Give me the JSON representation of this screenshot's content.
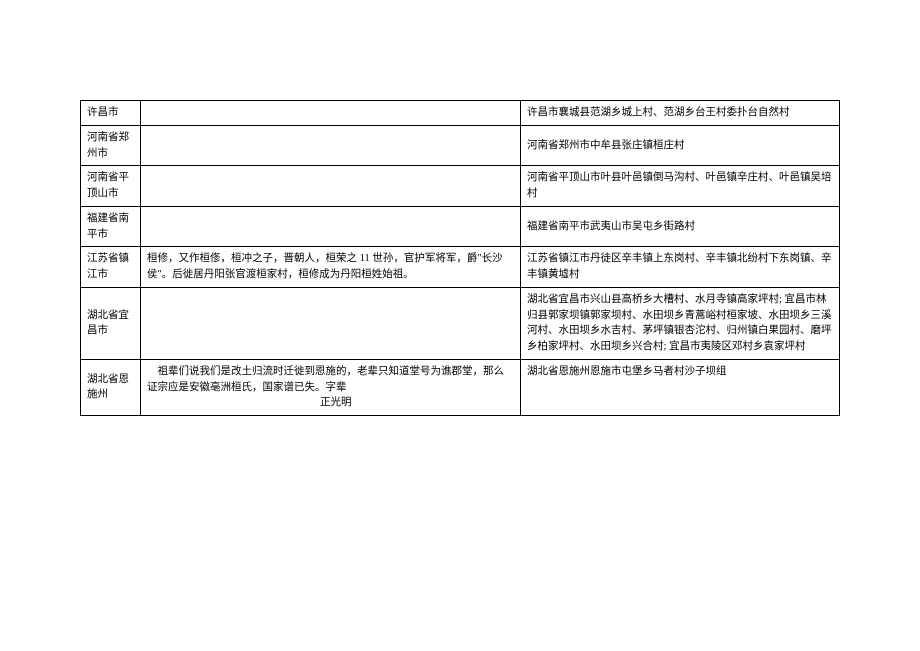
{
  "table": {
    "rows": [
      {
        "c1": "许昌市",
        "c2": "",
        "c3": "许昌市襄城县范湖乡城上村、范湖乡台王村委扑台自然村"
      },
      {
        "c1": "河南省郑州市",
        "c2": "",
        "c3": "河南省郑州市中牟县张庄镇桓庄村"
      },
      {
        "c1": "河南省平顶山市",
        "c2": "",
        "c3": "河南省平顶山市叶县叶邑镇倒马沟村、叶邑镇辛庄村、叶邑镇吴培村"
      },
      {
        "c1": "福建省南平市",
        "c2": "",
        "c3": "福建省南平市武夷山市吴屯乡街路村"
      },
      {
        "c1": "江苏省镇江市",
        "c2": "桓修，又作桓俢，桓冲之子，晋朝人，桓荣之 11 世孙，官护军将军，爵\"长沙侯\"。后徙居丹阳张官渡桓家村，桓修成为丹阳桓姓始祖。",
        "c3": "江苏省镇江市丹徒区辛丰镇上东岗村、辛丰镇北纷村下东岗镇、辛丰镇黄墟村"
      },
      {
        "c1": "湖北省宜昌市",
        "c2": "",
        "c3": "湖北省宜昌市兴山县高桥乡大槽村、水月寺镇高家坪村; 宜昌市林归县郭家坝镇郭家坝村、水田坝乡青蒿峪村桓家坡、水田坝乡三溪河村、水田坝乡水吉村、茅坪镇银杏沱村、归州镇白果园村、磨坪乡柏家坪村、水田坝乡兴合村; 宜昌市夷陵区邓村乡袁家坪村"
      },
      {
        "c1": "湖北省恩施州",
        "c2_line1": "祖辈们说我们是改土归流时迁徙到恩施的，老辈只知道堂号为谯郡堂，那么证宗应是安徽亳洲桓氏，国家谱已失。字辈",
        "c2_line2": "正光明",
        "c3": "湖北省恩施州恩施市屯堡乡马者村沙子坝组"
      }
    ]
  }
}
